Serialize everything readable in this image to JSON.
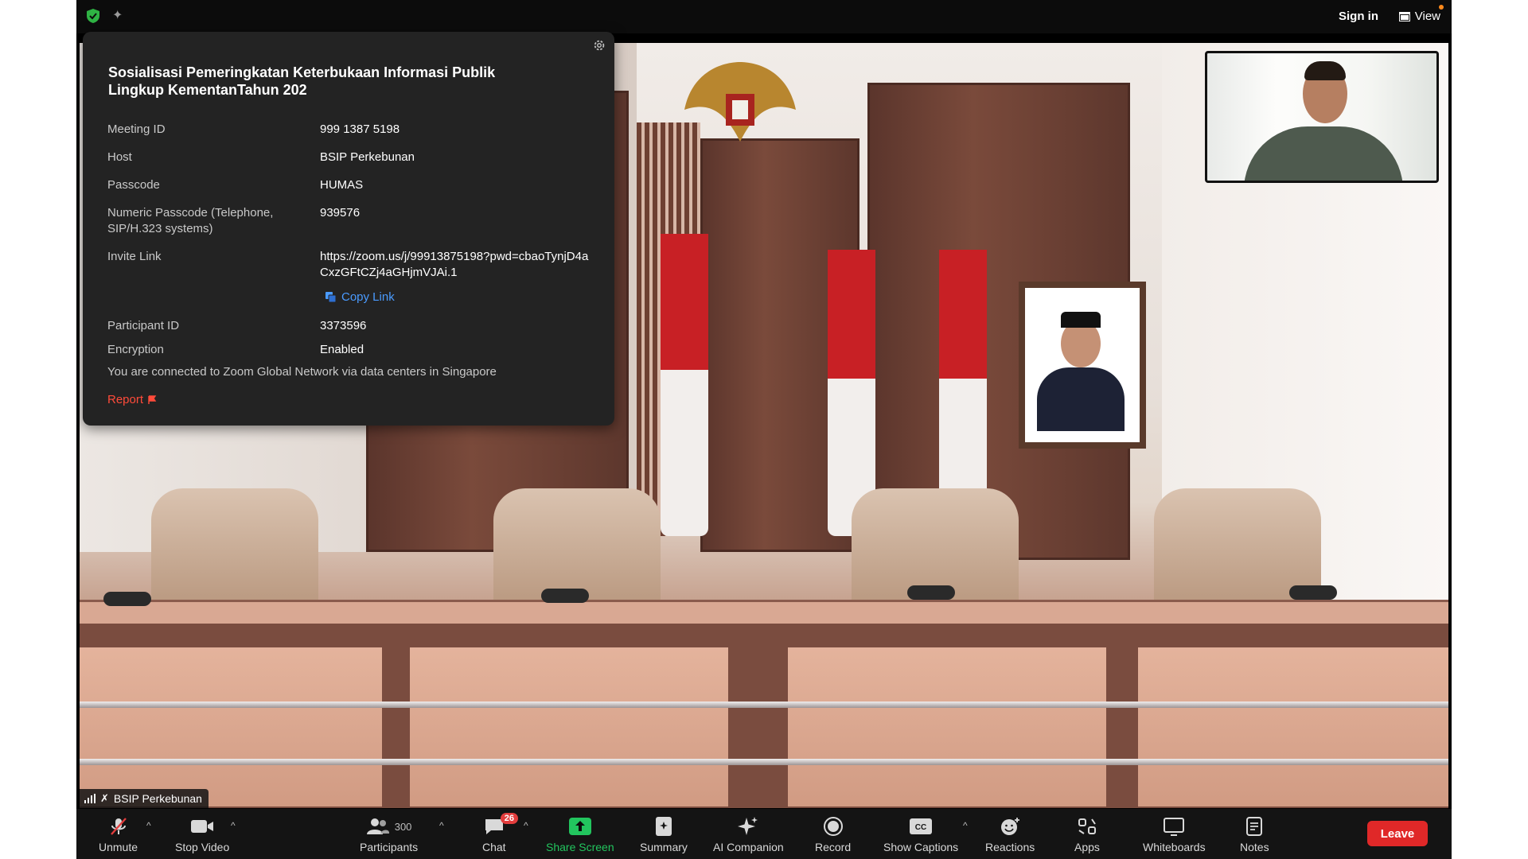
{
  "topbar": {
    "sign_in": "Sign in",
    "view": "View",
    "shield_color": "#2fb344"
  },
  "meeting_info": {
    "title": "Sosialisasi Pemeringkatan Keterbukaan Informasi Publik Lingkup KementanTahun 202",
    "rows": [
      {
        "key": "Meeting ID",
        "value": "999 1387 5198"
      },
      {
        "key": "Host",
        "value": "BSIP Perkebunan"
      },
      {
        "key": "Passcode",
        "value": "HUMAS"
      },
      {
        "key": "Numeric Passcode (Telephone, SIP/H.323 systems)",
        "value": "939576"
      },
      {
        "key": "Invite Link",
        "value": "https://zoom.us/j/99913875198?pwd=cbaoTynjD4aCxzGFtCZj4aGHjmVJAi.1"
      }
    ],
    "copy_link": "Copy Link",
    "rows2": [
      {
        "key": "Participant ID",
        "value": "3373596"
      },
      {
        "key": "Encryption",
        "value": "Enabled"
      }
    ],
    "network": "You are connected to Zoom Global Network via data centers in Singapore",
    "report": "Report"
  },
  "video": {
    "speaker_name": "BSIP Perkebunan"
  },
  "toolbar": {
    "unmute": "Unmute",
    "stop_video": "Stop Video",
    "participants": "Participants",
    "participant_count": "300",
    "chat": "Chat",
    "chat_badge": "26",
    "share_screen": "Share Screen",
    "summary": "Summary",
    "ai_companion": "AI Companion",
    "record": "Record",
    "show_captions": "Show Captions",
    "reactions": "Reactions",
    "apps": "Apps",
    "whiteboards": "Whiteboards",
    "notes": "Notes",
    "leave": "Leave",
    "share_color": "#22c55e",
    "leave_color": "#e02828"
  }
}
